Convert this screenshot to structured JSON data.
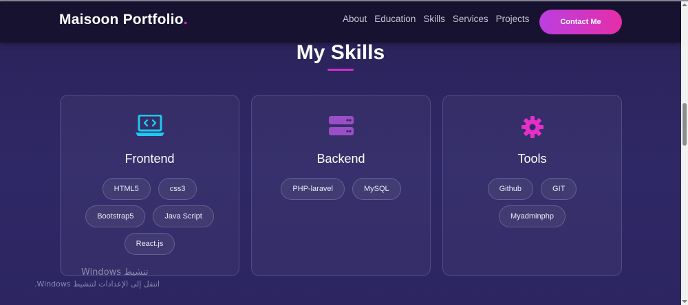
{
  "nav": {
    "brand": "Maisoon Portfolio",
    "brand_dot": ".",
    "links": [
      "About",
      "Education",
      "Skills",
      "Services",
      "Projects"
    ],
    "contact_label": "Contact Me"
  },
  "section": {
    "title": "My Skills"
  },
  "cards": [
    {
      "title": "Frontend",
      "icon": "laptop-code-icon",
      "chips": [
        "HTML5",
        "css3",
        "Bootstrap5",
        "Java Script",
        "React.js"
      ]
    },
    {
      "title": "Backend",
      "icon": "server-icon",
      "chips": [
        "PHP-laravel",
        "MySQL"
      ]
    },
    {
      "title": "Tools",
      "icon": "gear-icon",
      "chips": [
        "Github",
        "GIT",
        "Myadminphp"
      ]
    }
  ],
  "watermark": {
    "line1": "تنشيط Windows",
    "line2": "انتقل إلى الإعدادات لتنشيط Windows."
  },
  "colors": {
    "accent_pink": "#e42fc8",
    "accent_cyan": "#1ec8f0",
    "accent_purple": "#9b4fc6",
    "navbar_bg": "#17122f",
    "page_bg": "#2c2561"
  }
}
